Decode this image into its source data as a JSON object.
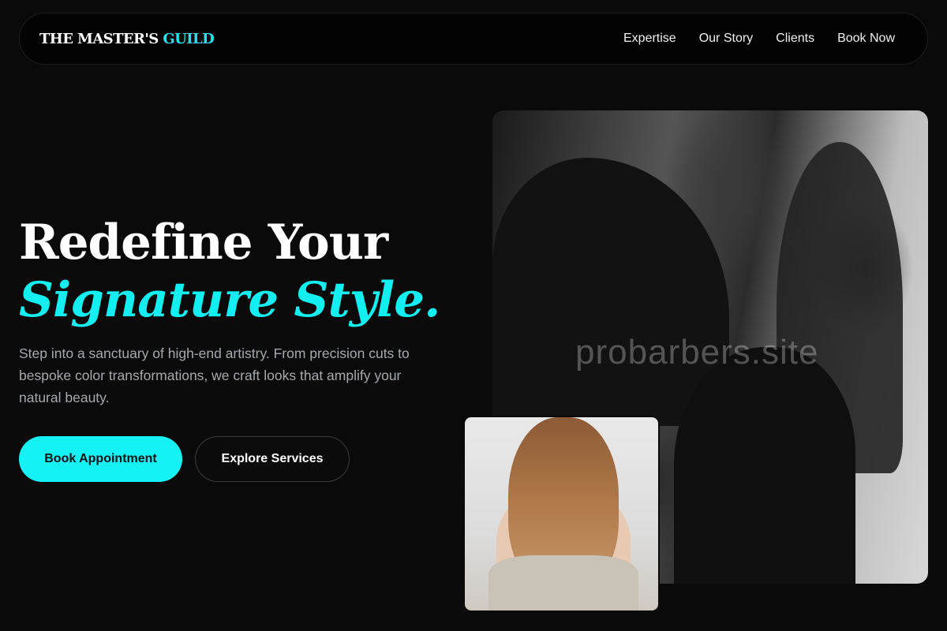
{
  "brand": {
    "name_part1": "THE MASTER'S",
    "name_part2": "GUILD",
    "accent_color": "#21e4ec"
  },
  "nav": {
    "links": [
      "Expertise",
      "Our Story",
      "Clients",
      "Book Now"
    ]
  },
  "hero": {
    "title_line1": "Redefine Your",
    "title_line2": "Signature Style.",
    "description": "Step into a sanctuary of high-end artistry. From precision cuts to bespoke color transformations, we craft looks that amplify your natural beauty.",
    "primary_cta": "Book Appointment",
    "secondary_cta": "Explore Services"
  },
  "images": {
    "main_watermark": "probarbers.site"
  }
}
